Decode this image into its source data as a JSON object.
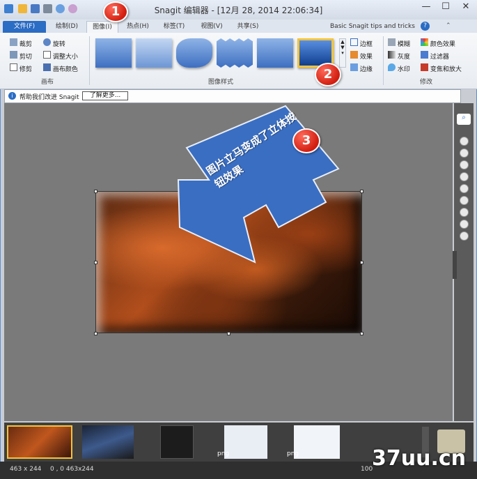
{
  "window": {
    "title": "Snagit 编辑器 - [12月 28, 2014 22:06:34]",
    "minimize": "—",
    "maximize": "☐",
    "close": "✕"
  },
  "tabs": [
    {
      "label": "文件(F)"
    },
    {
      "label": "绘制(D)"
    },
    {
      "label": "图像(I)"
    },
    {
      "label": "热点(H)"
    },
    {
      "label": "标签(T)"
    },
    {
      "label": "视图(V)"
    },
    {
      "label": "共享(S)"
    }
  ],
  "help_link": "Basic Snagit tips and tricks",
  "ribbon": {
    "canvas_group": {
      "title": "画布",
      "crop": "裁剪",
      "cutout": "剪切",
      "trim": "修剪",
      "rotate": "旋转",
      "resize": "调整大小",
      "canvas_color": "画布颜色"
    },
    "styles_group": {
      "title": "图像样式"
    },
    "effects": {
      "border": "边框",
      "effects": "效果",
      "edges": "边缘"
    },
    "modify_group": {
      "title": "修改",
      "blur": "模糊",
      "grayscale": "灰度",
      "watermark": "水印",
      "color_effects": "颜色效果",
      "filters": "过滤器",
      "spotlight_magnify": "变焦和放大"
    }
  },
  "infobar": {
    "text": "帮助我们改进 Snagit",
    "button": "了解更多..."
  },
  "annotation": {
    "arrow_text": "图片立马变成了立体按钮效果",
    "badge1": "1",
    "badge2": "2",
    "badge3": "3"
  },
  "filmstrip": {
    "items": [
      {
        "label": ""
      },
      {
        "label": ""
      },
      {
        "label": ""
      },
      {
        "label": "png"
      },
      {
        "label": "png"
      }
    ]
  },
  "status": {
    "dimensions": "463 x 244",
    "position": "0 , 0  463x244",
    "zoom": "100"
  },
  "watermark_site": "37uu.cn",
  "colors": {
    "accent": "#2b6cc4",
    "badge": "#d11e10",
    "arrow": "#3a6ec2"
  }
}
